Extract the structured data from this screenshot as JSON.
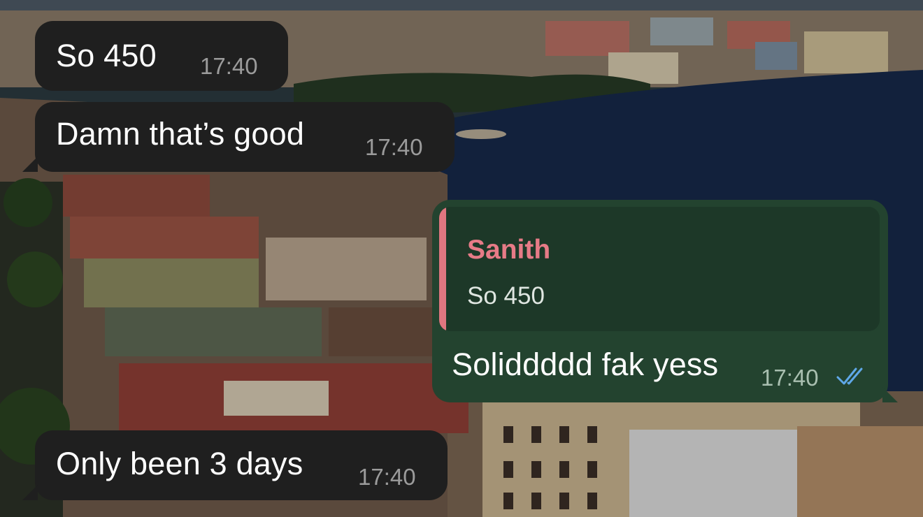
{
  "messages": [
    {
      "direction": "incoming",
      "text": "So 450",
      "time": "17:40"
    },
    {
      "direction": "incoming",
      "text": "Damn that’s good",
      "time": "17:40"
    },
    {
      "direction": "outgoing",
      "reply_to": {
        "author": "Sanith",
        "text": "So 450"
      },
      "text": "Soliddddd fak yess",
      "time": "17:40",
      "status": "read",
      "status_icon": "double-check-icon"
    },
    {
      "direction": "incoming",
      "text": "Only been 3 days",
      "time": "17:40"
    }
  ],
  "colors": {
    "incoming_bubble": "#1f1f1f",
    "outgoing_bubble": "#23432f",
    "reply_author": "#e77b87",
    "reply_bar": "#e07680",
    "read_check": "#5fa8e8"
  }
}
